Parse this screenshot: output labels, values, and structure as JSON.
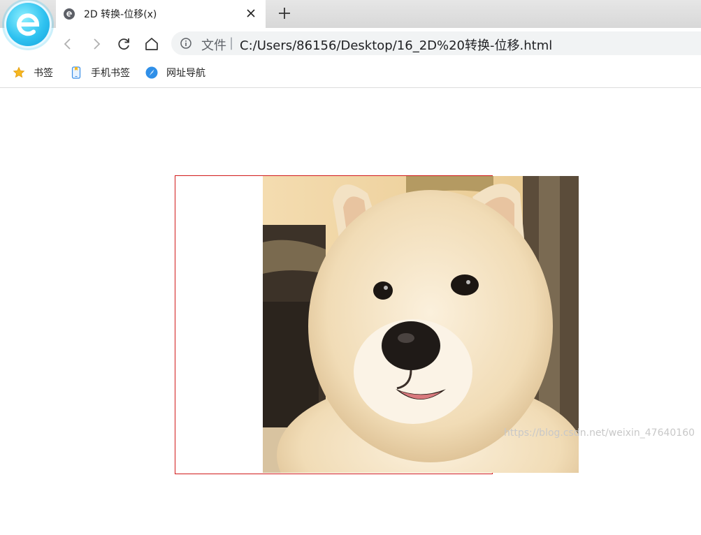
{
  "tab": {
    "title": "2D 转换-位移(x)",
    "close_icon": "close-icon",
    "new_tab_icon": "plus-icon"
  },
  "toolbar": {
    "back_icon": "back-icon",
    "forward_icon": "forward-icon",
    "reload_icon": "reload-icon",
    "home_icon": "home-icon"
  },
  "address": {
    "scheme_label": "文件",
    "separator": "|",
    "url": "C:/Users/86156/Desktop/16_2D%20转换-位移.html"
  },
  "bookmarks": [
    {
      "label": "书签",
      "icon": "star-icon"
    },
    {
      "label": "手机书签",
      "icon": "phone-icon"
    },
    {
      "label": "网址导航",
      "icon": "compass-icon"
    }
  ],
  "page": {
    "image_alt": "dog photo",
    "watermark": "https://blog.csdn.net/weixin_47640160"
  },
  "colors": {
    "box_border": "#d11a1a",
    "browser_accent": "#2fc2f0"
  }
}
